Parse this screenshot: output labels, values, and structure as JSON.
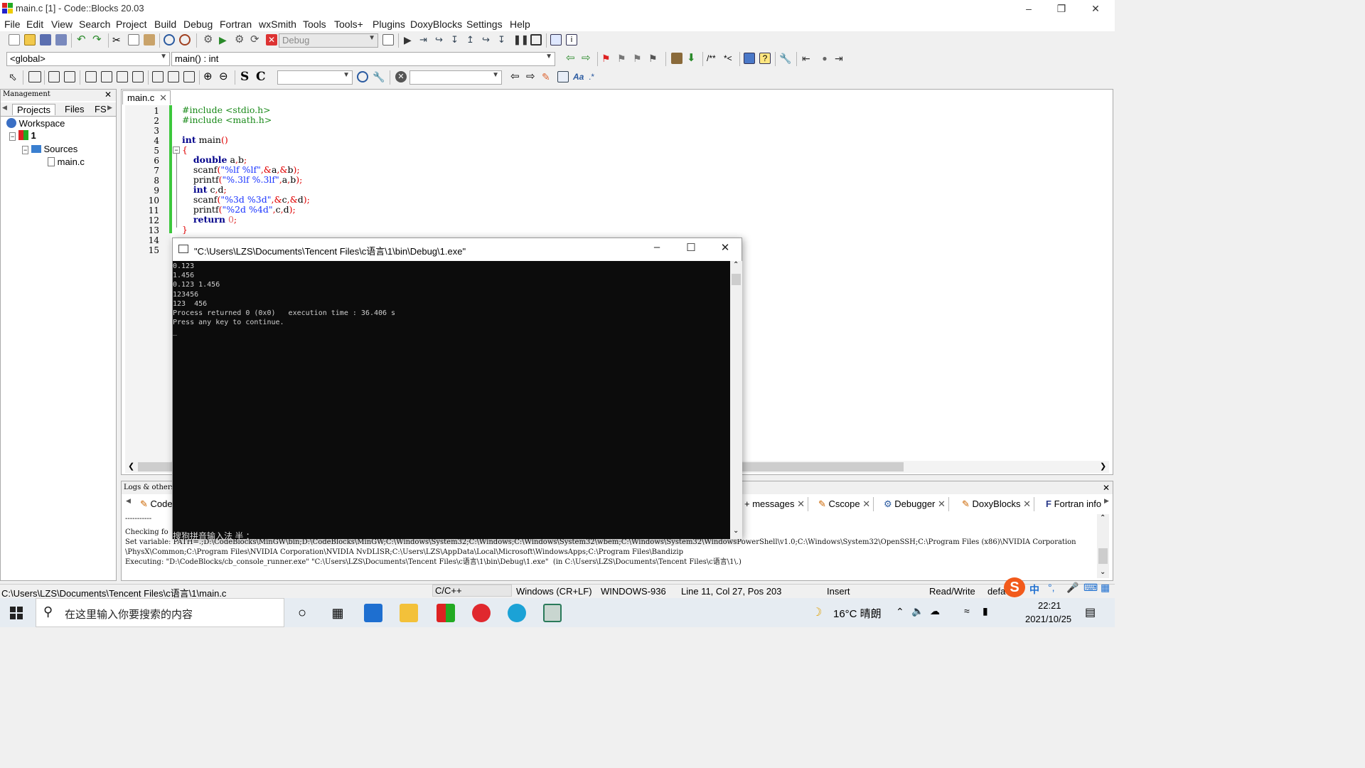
{
  "window": {
    "title": "main.c [1] - Code::Blocks 20.03"
  },
  "menu": [
    "File",
    "Edit",
    "View",
    "Search",
    "Project",
    "Build",
    "Debug",
    "Fortran",
    "wxSmith",
    "Tools",
    "Tools+",
    "Plugins",
    "DoxyBlocks",
    "Settings",
    "Help"
  ],
  "toolbar": {
    "build_target": "Debug",
    "scope": "<global>",
    "function": "main() : int"
  },
  "management": {
    "title": "Management",
    "tabs": [
      "Projects",
      "Files",
      "FS"
    ],
    "workspace": "Workspace",
    "project": "1",
    "sources": "Sources",
    "file": "main.c"
  },
  "editor": {
    "tab": "main.c",
    "line_numbers": [
      "1",
      "2",
      "3",
      "4",
      "5",
      "6",
      "7",
      "8",
      "9",
      "10",
      "11",
      "12",
      "13",
      "14",
      "15"
    ]
  },
  "console": {
    "title": "\"C:\\Users\\LZS\\Documents\\Tencent Files\\c语言\\1\\bin\\Debug\\1.exe\"",
    "output": "0.123\n1.456\n0.123 1.456\n123456\n123  456\nProcess returned 0 (0x0)   execution time : 36.406 s\nPress any key to continue.\n_",
    "ime": "搜狗拼音输入法 半 ："
  },
  "logs": {
    "title": "Logs & others",
    "tabs": [
      "Code",
      "+ messages",
      "Cscope",
      "Debugger",
      "DoxyBlocks",
      "Fortran info"
    ],
    "lines": [
      "-----------",
      "Checking fo",
      "Set variable: PATH=.;D:\\CodeBlocks\\MinGW\\bin;D:\\CodeBlocks\\MinGW;C:\\Windows\\System32;C:\\Windows;C:\\Windows\\System32\\wbem;C:\\Windows\\System32\\WindowsPowerShell\\v1.0;C:\\Windows\\System32\\OpenSSH;C:\\Program Files (x86)\\NVIDIA Corporation",
      "\\PhysX\\Common;C:\\Program Files\\NVIDIA Corporation\\NVIDIA NvDLISR;C:\\Users\\LZS\\AppData\\Local\\Microsoft\\WindowsApps;C:\\Program Files\\Bandizip",
      "Executing: \"D:\\CodeBlocks/cb_console_runner.exe\" \"C:\\Users\\LZS\\Documents\\Tencent Files\\c语言\\1\\bin\\Debug\\1.exe\"  (in C:\\Users\\LZS\\Documents\\Tencent Files\\c语言\\1\\.)"
    ]
  },
  "status": {
    "path": "C:\\Users\\LZS\\Documents\\Tencent Files\\c语言\\1\\main.c",
    "lang": "C/C++",
    "eol": "Windows (CR+LF)",
    "encoding": "WINDOWS-936",
    "position": "Line 11, Col 27, Pos 203",
    "mode": "Insert",
    "access": "Read/Write",
    "profile": "defa"
  },
  "taskbar": {
    "search_placeholder": "在这里输入你要搜索的内容",
    "weather": "16°C 晴朗",
    "time": "22:21",
    "date": "2021/10/25",
    "ime_lang": "中"
  }
}
